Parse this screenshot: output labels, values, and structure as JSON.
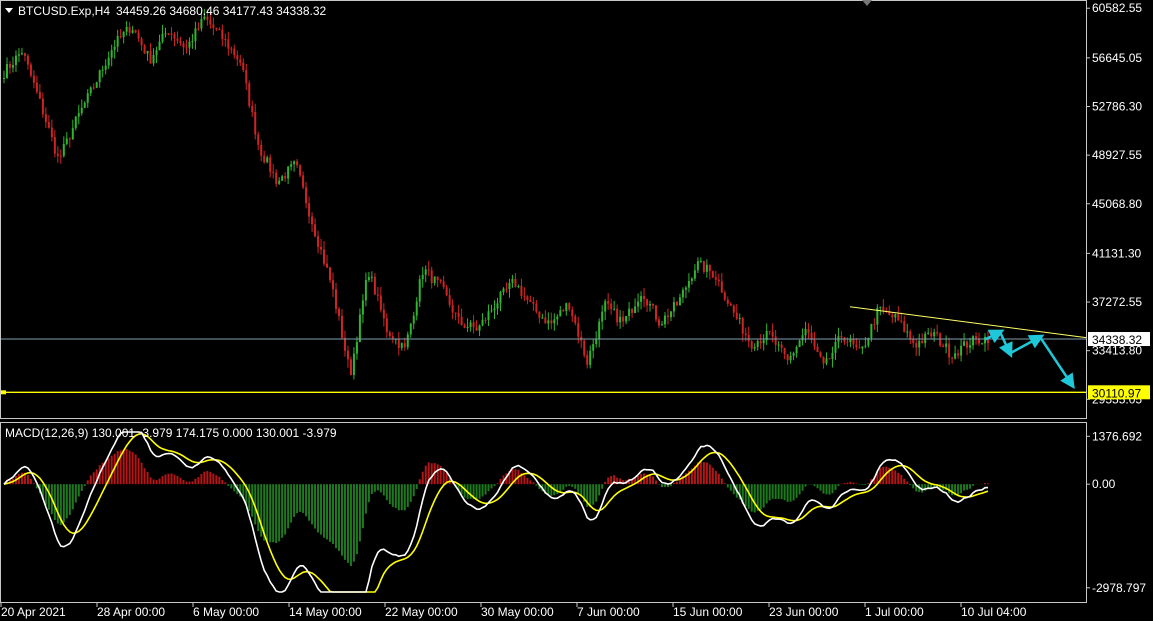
{
  "chart_data": [
    {
      "type": "candlestick",
      "symbol_label": "BTCUSD.Exp,H4",
      "ohlc_label": "34459.26 34680.46 34177.43 34338.32",
      "ylim": [
        29500,
        60600
      ],
      "y_ticks": [
        "60582.55",
        "56645.05",
        "52786.30",
        "48927.55",
        "45068.80",
        "41131.30",
        "37272.55",
        "33413.80",
        "29555.05"
      ],
      "y_tick_values": [
        60582.55,
        56645.05,
        52786.3,
        48927.55,
        45068.8,
        41131.3,
        37272.55,
        33413.8,
        29555.05
      ],
      "x_ticks": [
        "20 Apr 2021",
        "28 Apr 00:00",
        "6 May 00:00",
        "14 May 00:00",
        "22 May 00:00",
        "30 May 00:00",
        "7 Jun 00:00",
        "15 Jun 00:00",
        "23 Jun 00:00",
        "1 Jul 00:00",
        "10 Jul 04:00"
      ],
      "current_price": "34338.32",
      "support_level": {
        "value": 30110.97,
        "label": "30110.97"
      },
      "trendline": {
        "from": 36900,
        "to": 34450
      },
      "close_path_anchors": [
        55500,
        57200,
        53000,
        48500,
        51800,
        54600,
        57600,
        59200,
        56500,
        58900,
        57400,
        59800,
        58200,
        56300,
        49500,
        46800,
        48200,
        43200,
        38500,
        31500,
        39800,
        35100,
        33500,
        39900,
        38400,
        35600,
        35100,
        37200,
        38900,
        36800,
        35500,
        37200,
        32500,
        37000,
        35600,
        38200,
        35600,
        37200,
        40300,
        39500,
        36500,
        34000,
        34700,
        32500,
        35100,
        32000,
        34700,
        33100,
        36700,
        35900,
        33900,
        34800,
        33100,
        34100,
        34450
      ],
      "forecast_arrows_direction": "down"
    },
    {
      "type": "macd",
      "label": "MACD(12,26,9) 130.001 -3.979 174.175 0.000 130.001 -3.979",
      "ylim": [
        -3100,
        1500
      ],
      "y_ticks": [
        "1376.692",
        "0.00",
        "-2978.797"
      ],
      "y_tick_values": [
        1376.692,
        0,
        -2978.797
      ],
      "main_series": "white",
      "signal_series": "yellow",
      "histogram_colors": [
        "#b31616",
        "#1e7a1e"
      ]
    }
  ],
  "colors": {
    "background": "#000000",
    "bull_candle": "#2fb52f",
    "bear_candle": "#d02424",
    "support_line": "#ffff00",
    "trendline": "#ffff66",
    "price_line": "#7f9faf",
    "forecast_arrows": "#1ec8d8"
  }
}
